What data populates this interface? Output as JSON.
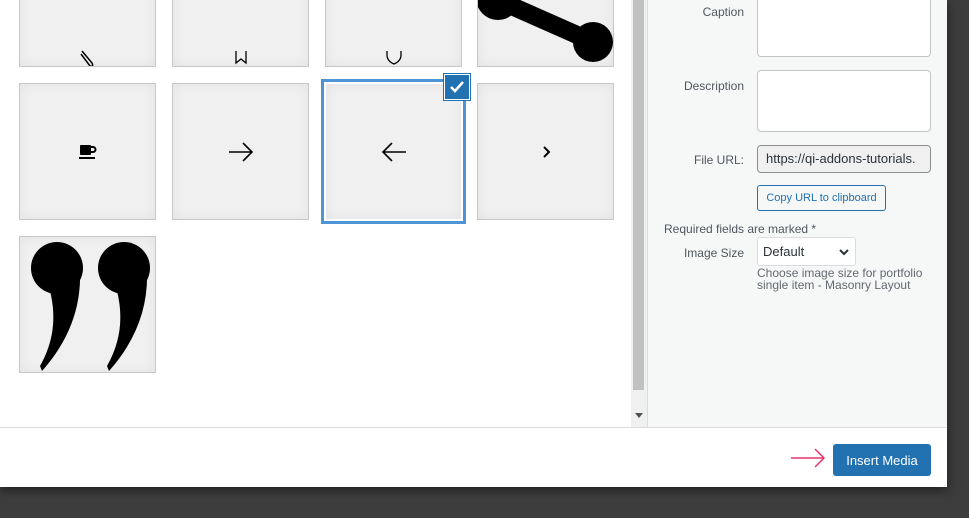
{
  "sidebar": {
    "caption_label": "Caption",
    "description_label": "Description",
    "file_url_label": "File URL:",
    "file_url_value": "https://qi-addons-tutorials.",
    "copy_url_label": "Copy URL to clipboard",
    "required_note": "Required fields are marked *",
    "image_size_label": "Image Size",
    "image_size_value": "Default",
    "image_size_help": "Choose image size for portfolio single item - Masonry Layout"
  },
  "grid": {
    "icons": [
      "paperclip",
      "bookmark",
      "shield",
      "share-node",
      "coffee-cup",
      "arrow-right",
      "arrow-left",
      "chevron-right",
      "quote"
    ],
    "selected": "arrow-left"
  },
  "footer": {
    "insert_label": "Insert Media",
    "annotation_arrow_color": "#e8336b"
  },
  "colors": {
    "accent": "#2271b1"
  }
}
